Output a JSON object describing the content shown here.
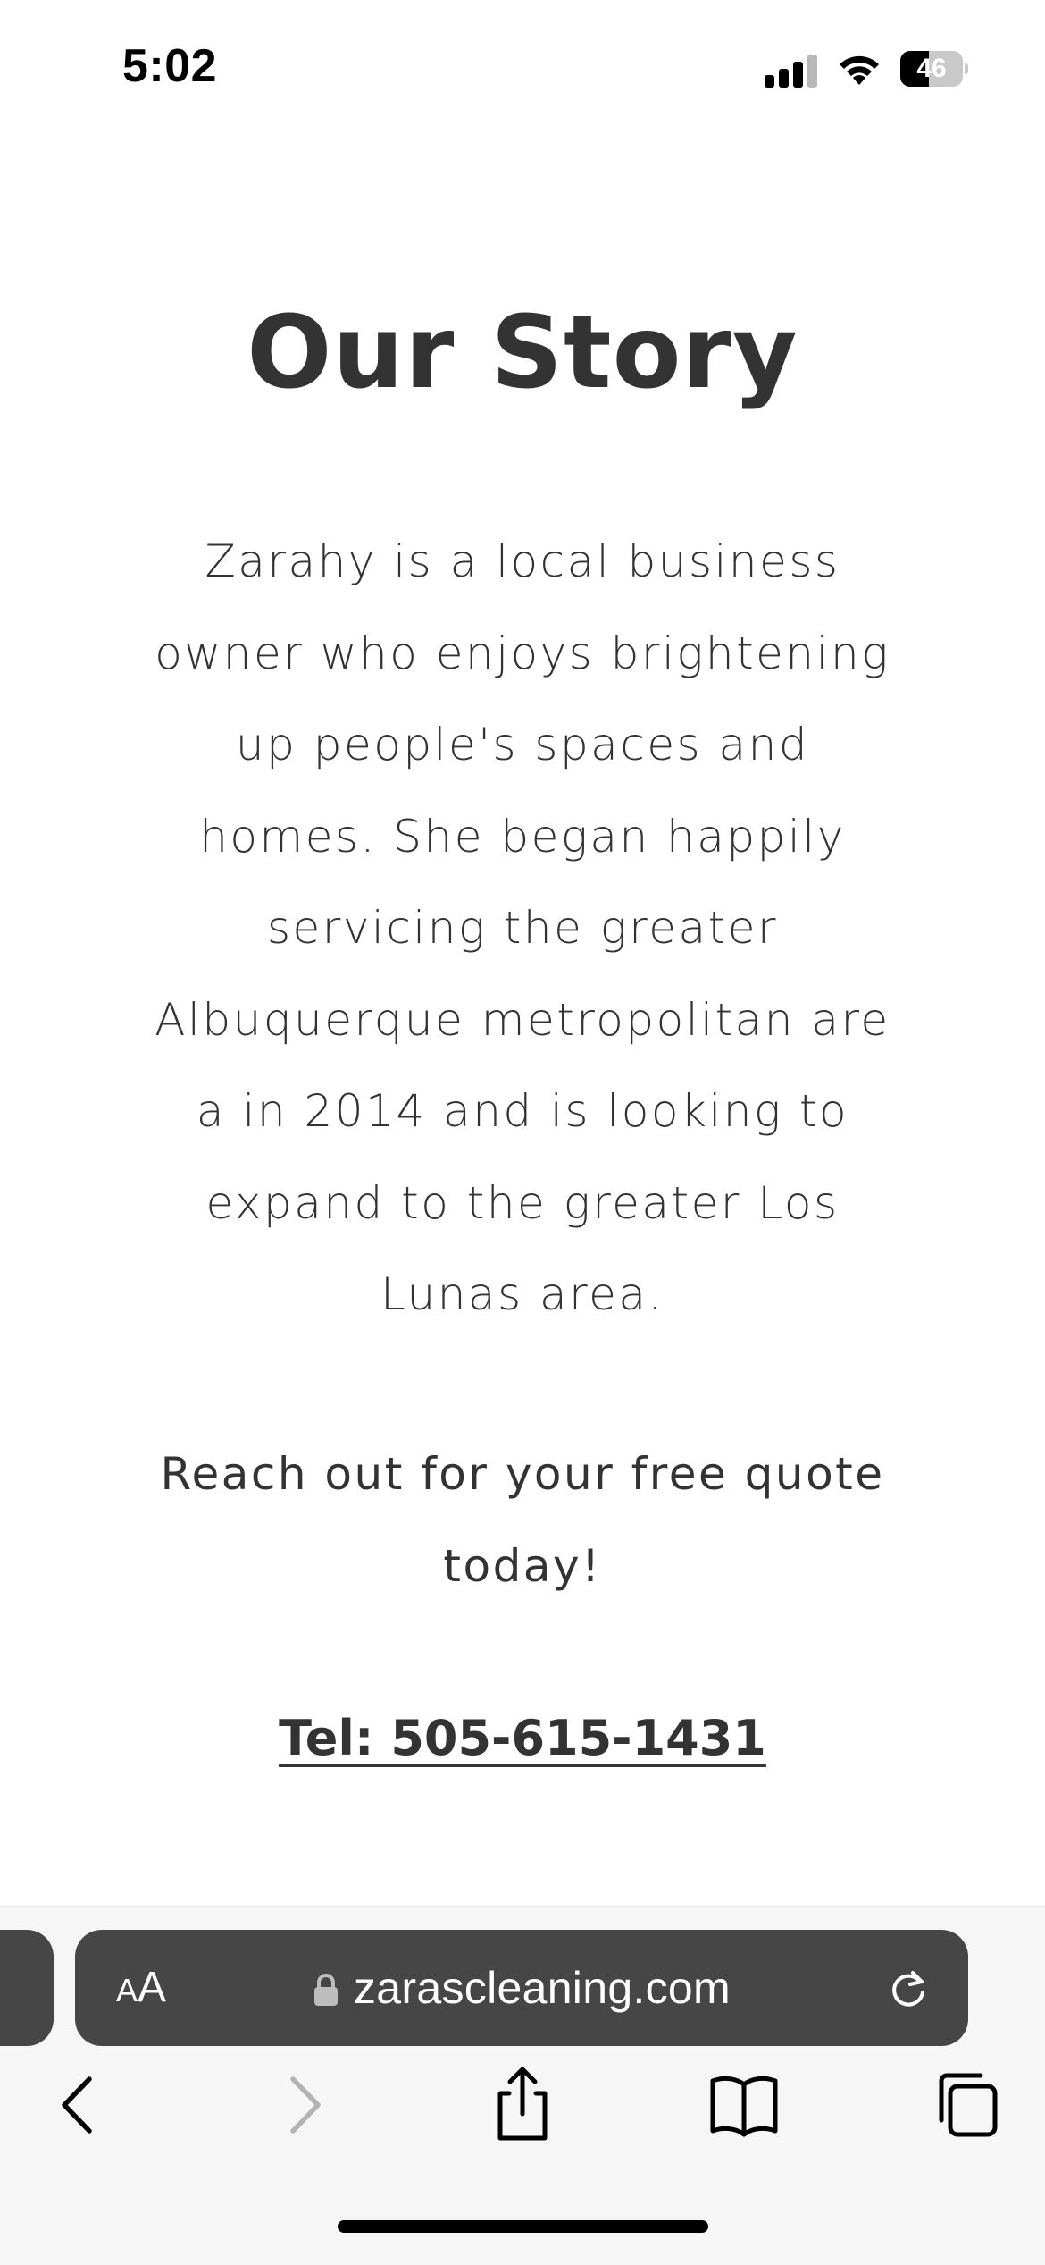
{
  "status_bar": {
    "time": "5:02",
    "battery_level": "46",
    "battery_fraction": 0.46,
    "signal_icon": "cellular-signal-icon",
    "wifi_icon": "wifi-icon",
    "battery_icon": "battery-icon"
  },
  "page": {
    "title": "Our Story",
    "story_paragraph": "Zarahy is a local business owner who enjoys brightening up people's spaces and homes.  She began happily servicing the greater Albuquerque metropolitan are a in 2014 and is looking to expand to the greater Los Lunas area.",
    "cta": "Reach out for your free quote today!",
    "phone": "Tel: 505-615-1431"
  },
  "browser": {
    "aa_small": "A",
    "aa_big": "A",
    "url": "zarascleaning.com",
    "lock_icon": "lock-icon",
    "reload_icon": "reload-icon",
    "toolbar_icons": [
      "back-chevron-icon",
      "forward-chevron-icon",
      "share-icon",
      "bookmarks-book-icon",
      "tabs-icon"
    ]
  },
  "colors": {
    "text": "#333333",
    "address_bar": "#464646",
    "toolbar_bg": "#f6f6f6",
    "accent": "#007aff"
  }
}
